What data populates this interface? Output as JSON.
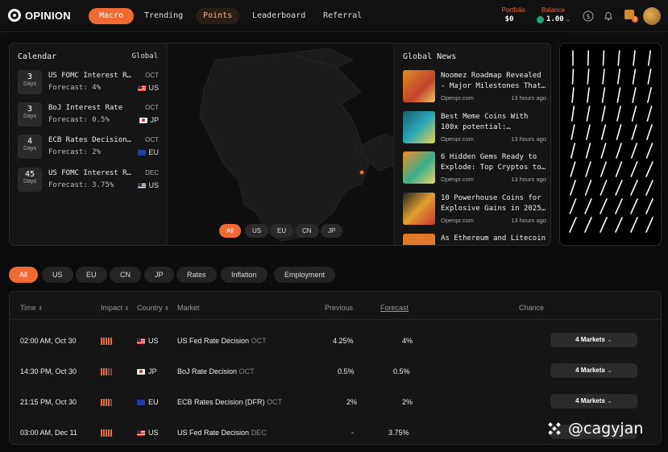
{
  "nav": {
    "logo": "OPINION",
    "items": [
      "Macro",
      "Trending",
      "Points",
      "Leaderboard",
      "Referral"
    ],
    "portfolio_label": "Portfolio",
    "portfolio_value": "$0",
    "balance_label": "Balance",
    "balance_value": "1.00",
    "badge_count": "1"
  },
  "calendar": {
    "title": "Calendar",
    "scope": "Global",
    "days_label": "Days",
    "events": [
      {
        "days": "3",
        "name": "US FOMC Interest Rate",
        "month": "OCT",
        "forecast": "Forecast: 4%",
        "region": "US"
      },
      {
        "days": "3",
        "name": "BoJ Interest Rate",
        "month": "OCT",
        "forecast": "Forecast: 0.5%",
        "region": "JP"
      },
      {
        "days": "4",
        "name": "ECB Rates Decision…",
        "month": "OCT",
        "forecast": "Forecast: 2%",
        "region": "EU"
      },
      {
        "days": "45",
        "name": "US FOMC Interest Rate",
        "month": "DEC",
        "forecast": "Forecast: 3.75%",
        "region": "US"
      }
    ]
  },
  "map": {
    "regions": [
      "All",
      "US",
      "EU",
      "CN",
      "JP"
    ]
  },
  "news": {
    "title": "Global News",
    "items": [
      {
        "headline": "Noomez Roadmap Revealed - Major Milestones That…",
        "source": "Openpr.com",
        "time": "13 hours ago"
      },
      {
        "headline": "Best Meme Coins With 100x potential:…",
        "source": "Openpr.com",
        "time": "13 hours ago"
      },
      {
        "headline": "6 Hidden Gems Ready to Explode: Top Cryptos to…",
        "source": "Openpr.com",
        "time": "13 hours ago"
      },
      {
        "headline": "10 Powerhouse Coins for Explosive Gains in 2025…",
        "source": "Openpr.com",
        "time": "13 hours ago"
      },
      {
        "headline": "As Ethereum and Litecoin",
        "source": "",
        "time": ""
      }
    ]
  },
  "filters": [
    "All",
    "US",
    "EU",
    "CN",
    "JP",
    "Rates",
    "Inflation",
    "Employment"
  ],
  "table": {
    "headers": {
      "time": "Time",
      "impact": "Impact",
      "country": "Country",
      "market": "Market",
      "previous": "Previous",
      "forecast": "Forecast",
      "chance": "Chance"
    },
    "rows": [
      {
        "time": "02:00 AM, Oct 30",
        "impact": 5,
        "country": "US",
        "market": "US Fed Rate Decision",
        "month": "OCT",
        "previous": "4.25%",
        "forecast": "4%",
        "markets": "4 Markets"
      },
      {
        "time": "14:30 PM, Oct 30",
        "impact": 3,
        "country": "JP",
        "market": "BoJ Rate Decision",
        "month": "OCT",
        "previous": "0.5%",
        "forecast": "0.5%",
        "markets": "4 Markets"
      },
      {
        "time": "21:15 PM, Oct 30",
        "impact": 4,
        "country": "EU",
        "market": "ECB Rates Decision (DFR)",
        "month": "OCT",
        "previous": "2%",
        "forecast": "2%",
        "markets": "4 Markets"
      },
      {
        "time": "03:00 AM, Dec 11",
        "impact": 5,
        "country": "US",
        "market": "US Fed Rate Decision",
        "month": "DEC",
        "previous": "-",
        "forecast": "3.75%",
        "markets": ""
      }
    ]
  },
  "watermark": "@cagyjan",
  "colors": {
    "accent": "#ef6a34",
    "bg": "#0c0c0c",
    "panel": "#151515"
  }
}
